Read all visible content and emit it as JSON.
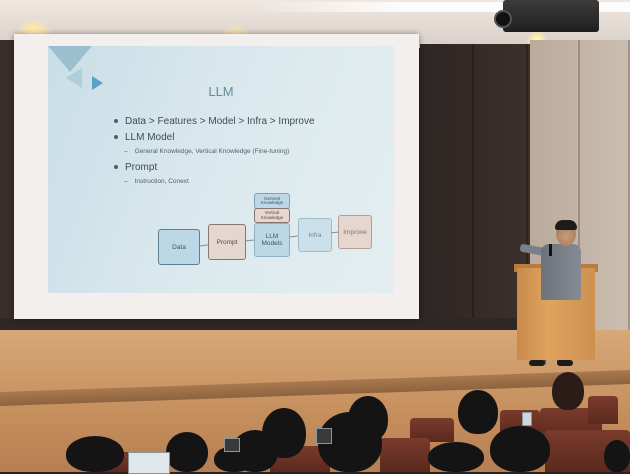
{
  "slide": {
    "title": "LLM",
    "bullets": [
      {
        "text": "Data > Features > Model > Infra > Improve",
        "subs": []
      },
      {
        "text": "LLM Model",
        "subs": [
          "General Knowledge, Vertical Knowledge (Fine-tuning)"
        ]
      },
      {
        "text": "Prompt",
        "subs": [
          "Instruction, Conext"
        ]
      }
    ],
    "diagram": {
      "data": "Data",
      "prompt": "Prompt",
      "llm": "LLM Models",
      "infra": "Infra",
      "improve": "Improve",
      "general_knowledge": "General Knowledge",
      "vertical_knowledge": "Vertical Knowledge"
    }
  },
  "colors": {
    "slide_background": "#d6e6ec",
    "box_blue": "#bcd7e5",
    "box_pink": "#e5d6cf",
    "podium": "#e0a35e",
    "stage_floor": "#c58e5d"
  }
}
